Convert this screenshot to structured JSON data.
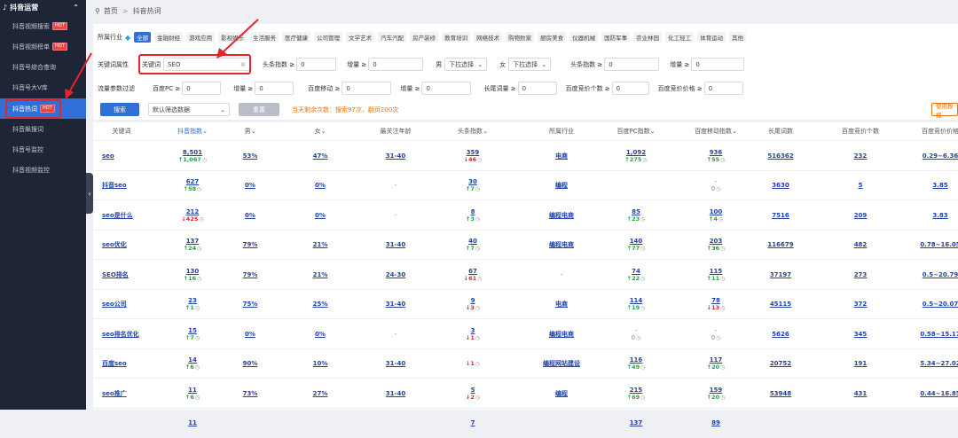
{
  "sidebar": {
    "section_title": "抖音运营",
    "items": [
      {
        "label": "抖音视频搜索",
        "hot": "HOT"
      },
      {
        "label": "抖音视频榜单",
        "hot": "HOT"
      },
      {
        "label": "抖音号综合查询",
        "hot": ""
      },
      {
        "label": "抖音号大V库",
        "hot": ""
      },
      {
        "label": "抖音热词",
        "hot": "HOT"
      },
      {
        "label": "抖音飙搜词",
        "hot": ""
      },
      {
        "label": "抖音号监控",
        "hot": ""
      },
      {
        "label": "抖音视频监控",
        "hot": ""
      }
    ]
  },
  "breadcrumb": {
    "home": "首页",
    "sep": ">",
    "current": "抖音热词"
  },
  "industry": {
    "label": "所属行业",
    "tags": [
      "全部",
      "金融财经",
      "游戏应用",
      "影视娱乐",
      "生活服务",
      "医疗健康",
      "公司管理",
      "文学艺术",
      "汽车汽配",
      "房产装修",
      "教育培训",
      "网络技术",
      "购物败家",
      "厨房美食",
      "仪器机械",
      "国防军事",
      "农业林园",
      "化工轻工",
      "体育运动",
      "其他"
    ]
  },
  "filters": {
    "row1_label": "关键词属性",
    "keyword_label": "关键词",
    "keyword_value": "SEO",
    "toutiao_label": "头条指数 ≥",
    "toutiao_value": "0",
    "inc1_label": "增量 ≥",
    "inc1_value": "0",
    "male_label": "男",
    "male_value": "下拉选择",
    "female_label": "女",
    "female_value": "下拉选择",
    "toutiao2_label": "头条指数 ≥",
    "toutiao2_value": "0",
    "inc2_label": "增量 ≥",
    "inc2_value": "0",
    "row2_label": "流量参数过滤",
    "pc_label": "百度PC ≥",
    "pc_value": "0",
    "inc3_label": "增量 ≥",
    "inc3_value": "0",
    "mobile_label": "百度移动 ≥",
    "mobile_value": "0",
    "inc4_label": "增量 ≥",
    "inc4_value": "0",
    "longtail_label": "长尾词量 ≥",
    "longtail_value": "0",
    "bid_count_label": "百度竞价个数 ≥",
    "bid_count_value": "0",
    "bid_price_label": "百度竞价价格 ≥",
    "bid_price_value": "0"
  },
  "actions": {
    "search": "搜索",
    "filter_default": "默认筛选数据",
    "reset": "重置",
    "quota": "当天剩余次数：搜索97次，翻页200次",
    "tutorial": "使用教程"
  },
  "columns": [
    "关键词",
    "抖音指数",
    "男",
    "女",
    "最关注年龄",
    "头条指数",
    "所属行业",
    "百度PC指数",
    "百度移动指数",
    "长尾词数",
    "百度竞价个数",
    "百度竞价价格"
  ],
  "rows": [
    {
      "kw": "seo",
      "dy": "8,501",
      "dy_ch": "↑1,067",
      "male": "53%",
      "female": "47%",
      "age": "31-40",
      "tt": "359",
      "tt_ch": "↓46",
      "ind": "电商",
      "pc": "1,092",
      "pc_ch": "↑275",
      "mob": "936",
      "mob_ch": "↑55",
      "lt": "516362",
      "bc": "232",
      "bp": "0.29~6.36"
    },
    {
      "kw": "抖音seo",
      "dy": "627",
      "dy_ch": "↑58",
      "male": "0%",
      "female": "0%",
      "age": "-",
      "tt": "30",
      "tt_ch": "↑7",
      "ind": "编程",
      "pc": "",
      "pc_ch": "",
      "mob": "-",
      "mob_ch": "0",
      "lt": "3630",
      "bc": "5",
      "bp": "3.85"
    },
    {
      "kw": "seo是什么",
      "dy": "212",
      "dy_ch": "↓425",
      "male": "0%",
      "female": "0%",
      "age": "-",
      "tt": "8",
      "tt_ch": "↑3",
      "ind": "编程电商",
      "pc": "85",
      "pc_ch": "↑23",
      "mob": "100",
      "mob_ch": "↑4",
      "lt": "7516",
      "bc": "209",
      "bp": "3.83"
    },
    {
      "kw": "seo优化",
      "dy": "137",
      "dy_ch": "↑24",
      "male": "79%",
      "female": "21%",
      "age": "31-40",
      "tt": "40",
      "tt_ch": "↑7",
      "ind": "编程电商",
      "pc": "140",
      "pc_ch": "↑77",
      "mob": "203",
      "mob_ch": "↑36",
      "lt": "116679",
      "bc": "482",
      "bp": "0.78~16.05"
    },
    {
      "kw": "SEO排名",
      "dy": "130",
      "dy_ch": "↑16",
      "male": "79%",
      "female": "21%",
      "age": "24-30",
      "tt": "67",
      "tt_ch": "↓61",
      "ind": "-",
      "pc": "74",
      "pc_ch": "↑22",
      "mob": "115",
      "mob_ch": "↑11",
      "lt": "37197",
      "bc": "273",
      "bp": "0.5~20.79"
    },
    {
      "kw": "seo公司",
      "dy": "23",
      "dy_ch": "↑1",
      "male": "75%",
      "female": "25%",
      "age": "31-40",
      "tt": "9",
      "tt_ch": "↓3",
      "ind": "电商",
      "pc": "114",
      "pc_ch": "↑19",
      "mob": "78",
      "mob_ch": "↓13",
      "lt": "45115",
      "bc": "372",
      "bp": "0.5~20.07"
    },
    {
      "kw": "seo排名优化",
      "dy": "15",
      "dy_ch": "↑7",
      "male": "0%",
      "female": "0%",
      "age": "-",
      "tt": "3",
      "tt_ch": "↓1",
      "ind": "编程电商",
      "pc": "-",
      "pc_ch": "0",
      "mob": "-",
      "mob_ch": "0",
      "lt": "5626",
      "bc": "345",
      "bp": "0.58~15.17"
    },
    {
      "kw": "百度seo",
      "dy": "14",
      "dy_ch": "↑6",
      "male": "90%",
      "female": "10%",
      "age": "31-40",
      "tt": "",
      "tt_ch": "↓1",
      "ind": "编程网站建设",
      "pc": "116",
      "pc_ch": "↑49",
      "mob": "117",
      "mob_ch": "↑20",
      "lt": "20752",
      "bc": "191",
      "bp": "5.34~27.02"
    },
    {
      "kw": "seo推广",
      "dy": "11",
      "dy_ch": "↑6",
      "male": "73%",
      "female": "27%",
      "age": "31-40",
      "tt": "5",
      "tt_ch": "↓2",
      "ind": "编程",
      "pc": "215",
      "pc_ch": "↑69",
      "mob": "159",
      "mob_ch": "↑20",
      "lt": "53948",
      "bc": "431",
      "bp": "0.44~16.85"
    },
    {
      "kw": "",
      "dy": "11",
      "dy_ch": "",
      "male": "",
      "female": "",
      "age": "",
      "tt": "7",
      "tt_ch": "",
      "ind": "",
      "pc": "137",
      "pc_ch": "",
      "mob": "89",
      "mob_ch": "",
      "lt": "",
      "bc": "",
      "bp": ""
    }
  ]
}
